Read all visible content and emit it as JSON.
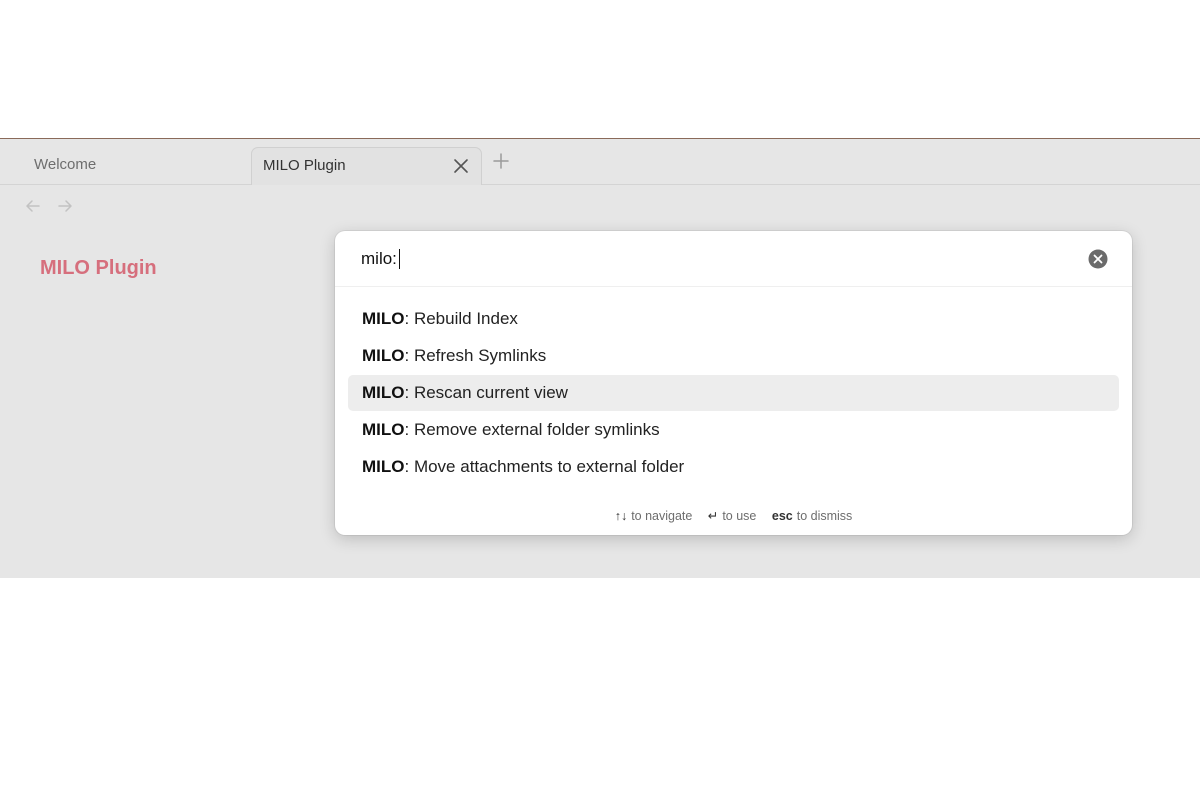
{
  "tabs": [
    {
      "label": "Welcome",
      "active": false
    },
    {
      "label": "MILO Plugin",
      "active": true
    }
  ],
  "note": {
    "title": "MILO Plugin"
  },
  "palette": {
    "query": "milo:",
    "results": [
      {
        "prefix": "MILO",
        "text": ": Rebuild Index",
        "selected": false
      },
      {
        "prefix": "MILO",
        "text": ": Refresh Symlinks",
        "selected": false
      },
      {
        "prefix": "MILO",
        "text": ": Rescan current view",
        "selected": true
      },
      {
        "prefix": "MILO",
        "text": ": Remove external folder symlinks",
        "selected": false
      },
      {
        "prefix": "MILO",
        "text": ": Move attachments to external folder",
        "selected": false
      }
    ],
    "footer": {
      "navigate_key": "↑↓",
      "navigate_label": "to navigate",
      "use_key": "↵",
      "use_label": "to use",
      "dismiss_key": "esc",
      "dismiss_label": "to dismiss"
    }
  },
  "colors": {
    "accent": "#d66f7d",
    "selected_row": "#ededed",
    "app_background": "#e6e6e6"
  }
}
